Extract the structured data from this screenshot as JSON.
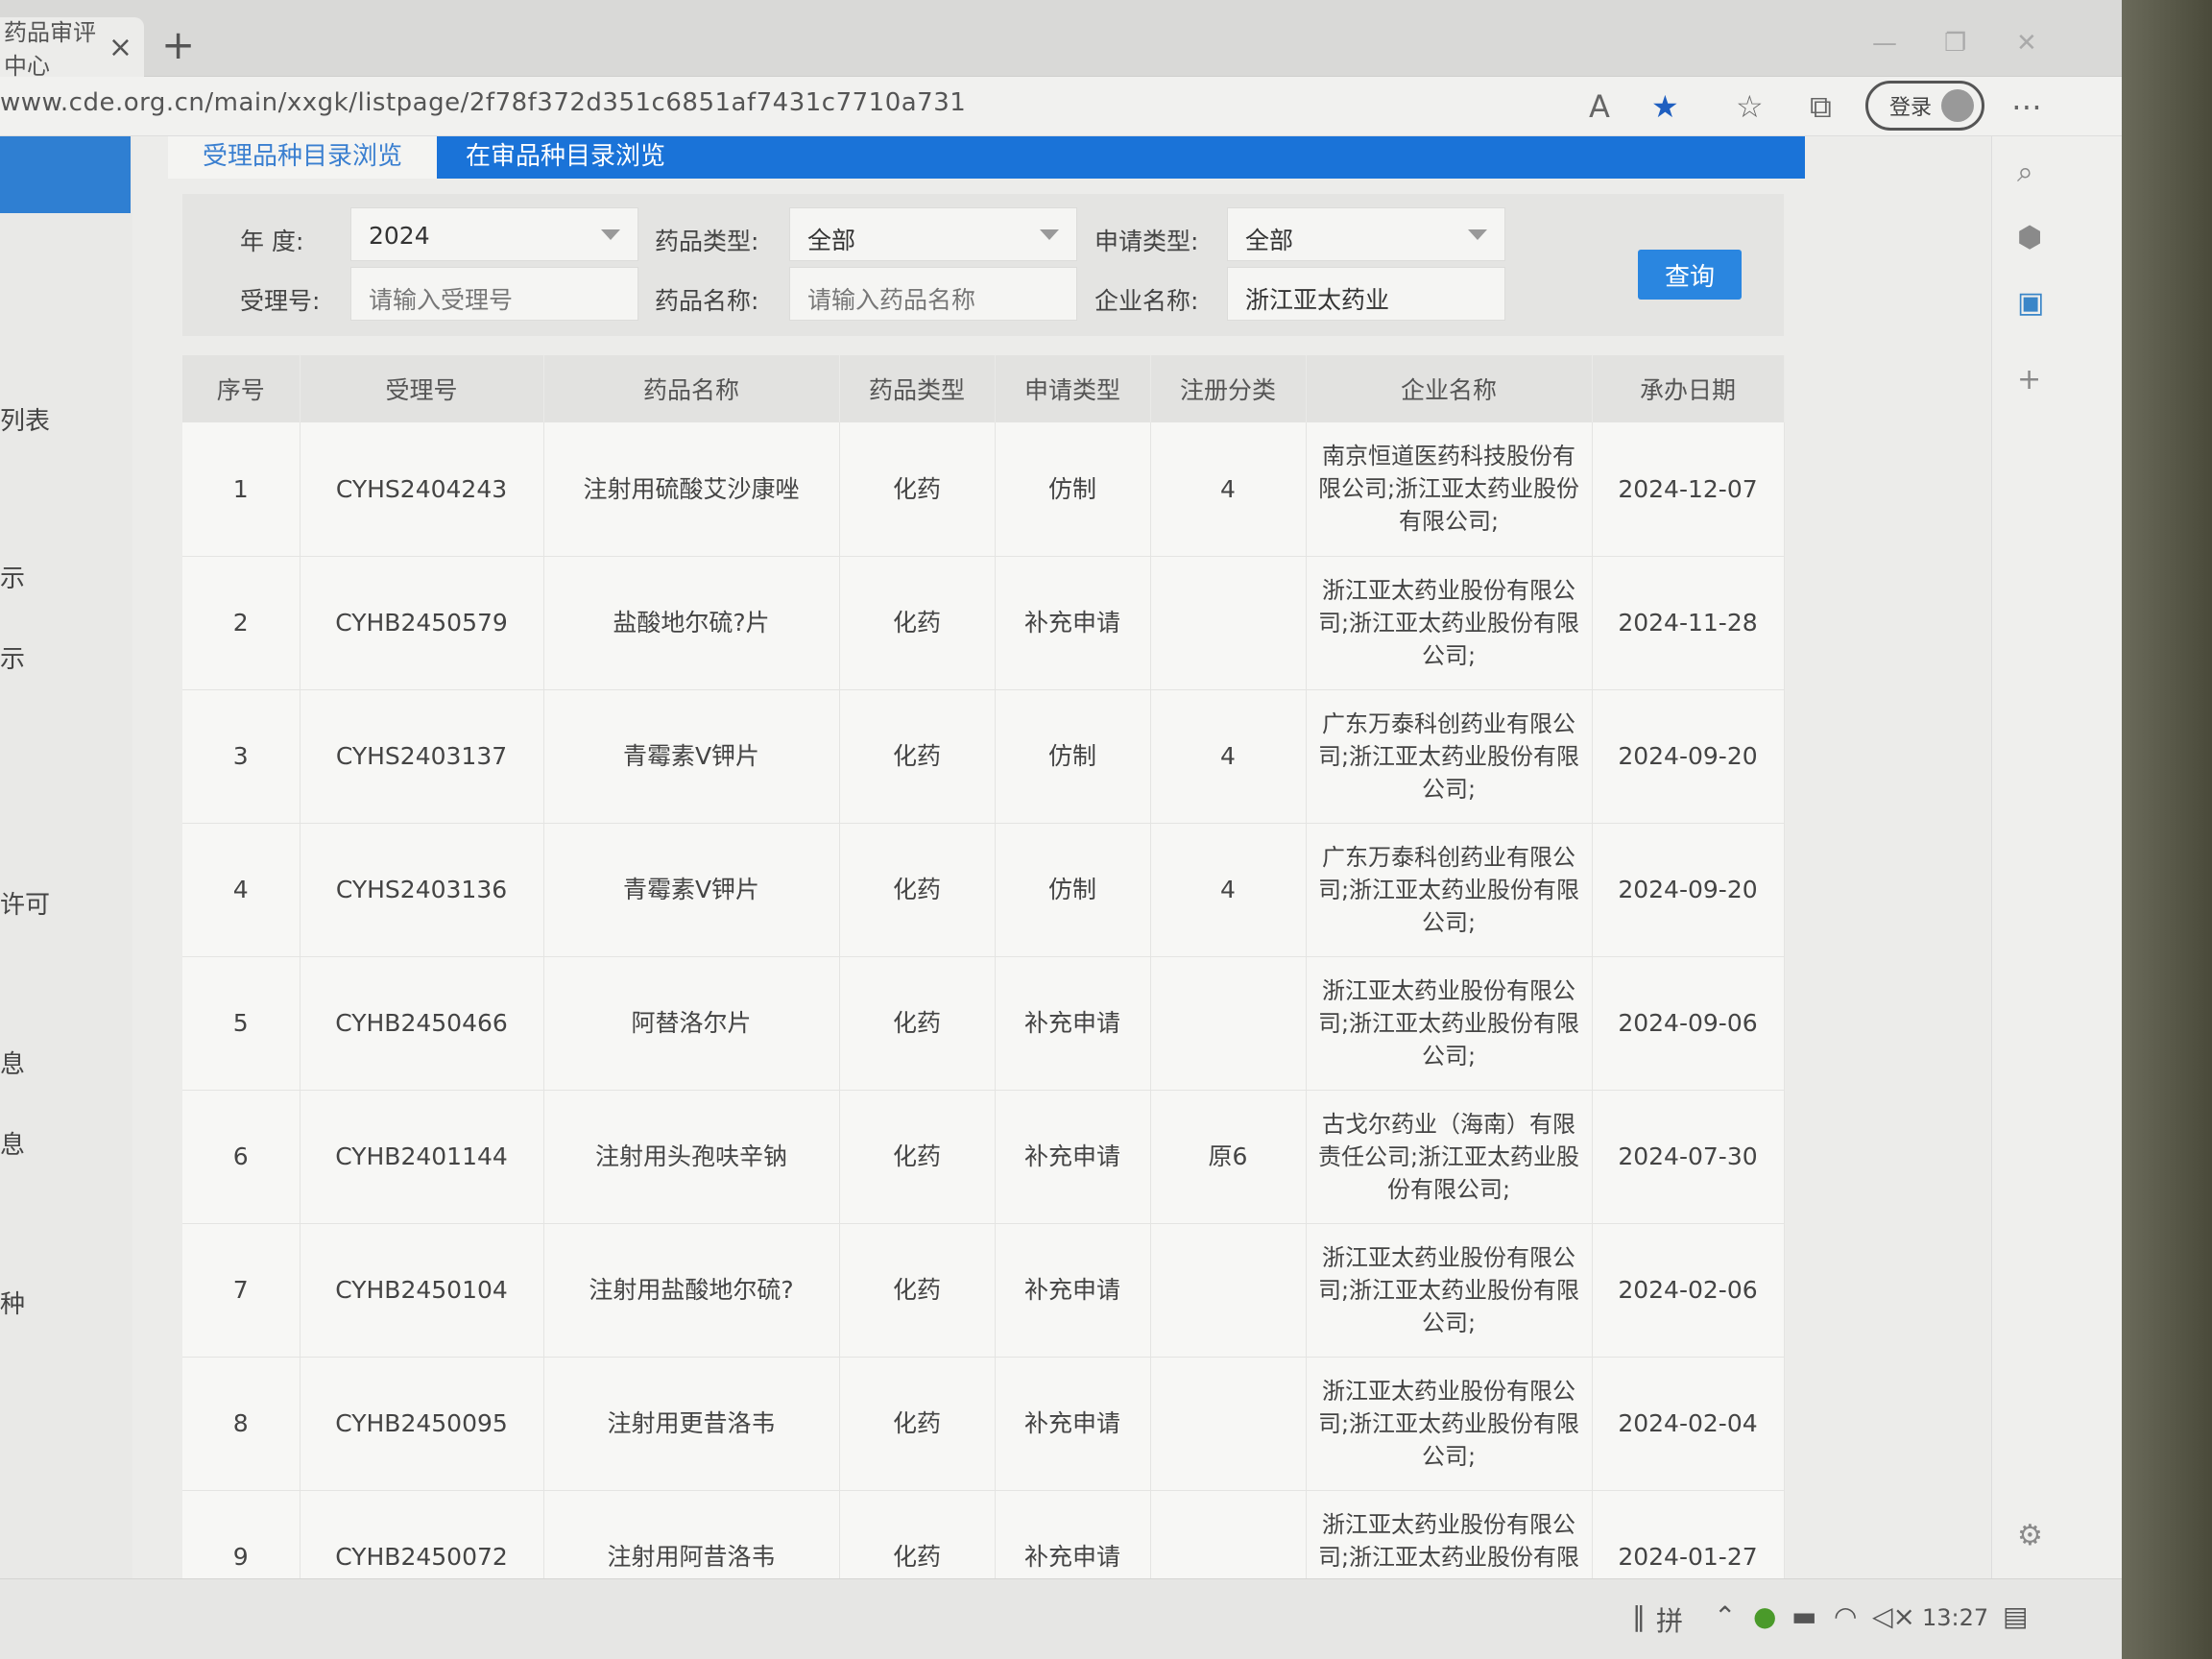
{
  "browser": {
    "tab_title": "药品审评中心",
    "url": "www.cde.org.cn/main/xxgk/listpage/2f78f372d351c6851af7431c7710a731",
    "login_label": "登录"
  },
  "leftnav": {
    "fragments": [
      "列表",
      "示",
      "示",
      "许可",
      "息",
      "息",
      "种"
    ]
  },
  "tabs": {
    "accepted": "受理品种目录浏览",
    "review": "在审品种目录浏览"
  },
  "filters": {
    "year_label": "年  度:",
    "year_value": "2024",
    "drug_type_label": "药品类型:",
    "drug_type_value": "全部",
    "apply_type_label": "申请类型:",
    "apply_type_value": "全部",
    "accept_no_label": "受理号:",
    "accept_no_placeholder": "请输入受理号",
    "drug_name_label": "药品名称:",
    "drug_name_placeholder": "请输入药品名称",
    "company_label": "企业名称:",
    "company_value": "浙江亚太药业",
    "query_label": "查询"
  },
  "table": {
    "headers": [
      "序号",
      "受理号",
      "药品名称",
      "药品类型",
      "申请类型",
      "注册分类",
      "企业名称",
      "承办日期"
    ],
    "rows": [
      {
        "no": "1",
        "accept_no": "CYHS2404243",
        "name": "注射用硫酸艾沙康唑",
        "type": "化药",
        "apply": "仿制",
        "cls": "4",
        "company": "南京恒道医药科技股份有限公司;浙江亚太药业股份有限公司;",
        "date": "2024-12-07"
      },
      {
        "no": "2",
        "accept_no": "CYHB2450579",
        "name": "盐酸地尔硫?片",
        "type": "化药",
        "apply": "补充申请",
        "cls": "",
        "company": "浙江亚太药业股份有限公司;浙江亚太药业股份有限公司;",
        "date": "2024-11-28"
      },
      {
        "no": "3",
        "accept_no": "CYHS2403137",
        "name": "青霉素V钾片",
        "type": "化药",
        "apply": "仿制",
        "cls": "4",
        "company": "广东万泰科创药业有限公司;浙江亚太药业股份有限公司;",
        "date": "2024-09-20"
      },
      {
        "no": "4",
        "accept_no": "CYHS2403136",
        "name": "青霉素V钾片",
        "type": "化药",
        "apply": "仿制",
        "cls": "4",
        "company": "广东万泰科创药业有限公司;浙江亚太药业股份有限公司;",
        "date": "2024-09-20"
      },
      {
        "no": "5",
        "accept_no": "CYHB2450466",
        "name": "阿替洛尔片",
        "type": "化药",
        "apply": "补充申请",
        "cls": "",
        "company": "浙江亚太药业股份有限公司;浙江亚太药业股份有限公司;",
        "date": "2024-09-06"
      },
      {
        "no": "6",
        "accept_no": "CYHB2401144",
        "name": "注射用头孢呋辛钠",
        "type": "化药",
        "apply": "补充申请",
        "cls": "原6",
        "company": "古戈尔药业（海南）有限责任公司;浙江亚太药业股份有限公司;",
        "date": "2024-07-30"
      },
      {
        "no": "7",
        "accept_no": "CYHB2450104",
        "name": "注射用盐酸地尔硫?",
        "type": "化药",
        "apply": "补充申请",
        "cls": "",
        "company": "浙江亚太药业股份有限公司;浙江亚太药业股份有限公司;",
        "date": "2024-02-06"
      },
      {
        "no": "8",
        "accept_no": "CYHB2450095",
        "name": "注射用更昔洛韦",
        "type": "化药",
        "apply": "补充申请",
        "cls": "",
        "company": "浙江亚太药业股份有限公司;浙江亚太药业股份有限公司;",
        "date": "2024-02-04"
      },
      {
        "no": "9",
        "accept_no": "CYHB2450072",
        "name": "注射用阿昔洛韦",
        "type": "化药",
        "apply": "补充申请",
        "cls": "",
        "company": "浙江亚太药业股份有限公司;浙江亚太药业股份有限公司;",
        "date": "2024-01-27"
      }
    ]
  },
  "taskbar": {
    "ime": "拼",
    "time": "13:27"
  },
  "colors": {
    "accent": "#1a73d8",
    "button": "#2a86e0"
  }
}
